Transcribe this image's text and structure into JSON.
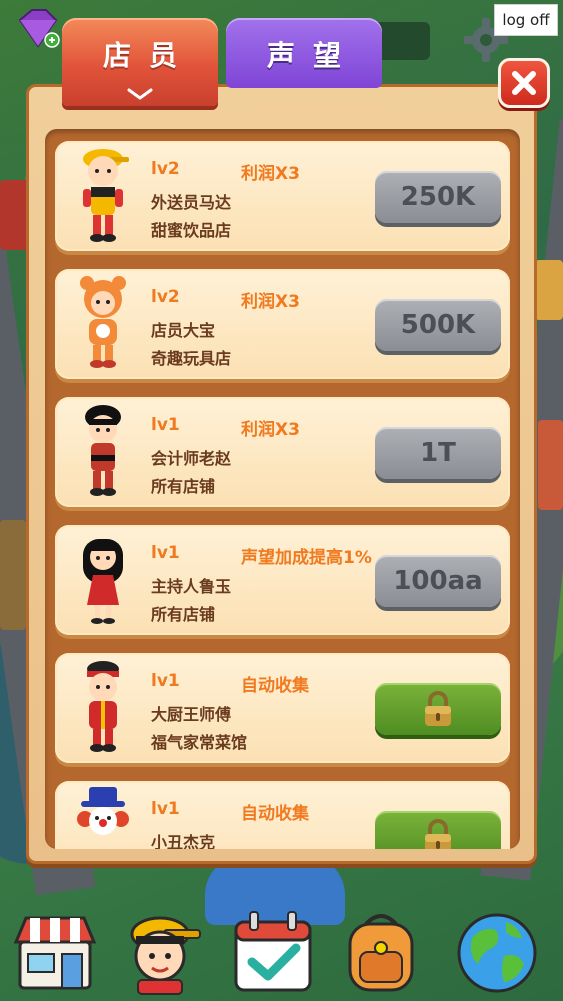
{
  "window": {
    "logoff_label": "log off"
  },
  "tabs": [
    {
      "label": "店员",
      "active": true
    },
    {
      "label": "声望",
      "active": false
    }
  ],
  "colors": {
    "tab_active": "#e1543a",
    "tab_inactive": "#8a4fde",
    "accent_text": "#f07a1f",
    "body_text": "#6a3b1f",
    "price_button": "#9a9da2",
    "lock_button": "#5e9a2a"
  },
  "staff": [
    {
      "level": "lv2",
      "bonus": "利润X3",
      "name": "外送员马达",
      "store": "甜蜜饮品店",
      "action": "price",
      "price": "250K",
      "avatar": "delivery-boy"
    },
    {
      "level": "lv2",
      "bonus": "利润X3",
      "name": "店员大宝",
      "store": "奇趣玩具店",
      "action": "price",
      "price": "500K",
      "avatar": "tiger-costume"
    },
    {
      "level": "lv1",
      "bonus": "利润X3",
      "name": "会计师老赵",
      "store": "所有店铺",
      "action": "price",
      "price": "1T",
      "avatar": "accountant"
    },
    {
      "level": "lv1",
      "bonus": "声望加成提高1%",
      "name": "主持人鲁玉",
      "store": "所有店铺",
      "action": "price",
      "price": "100aa",
      "avatar": "host-girl"
    },
    {
      "level": "lv1",
      "bonus": "自动收集",
      "name": "大厨王师傅",
      "store": "福气家常菜馆",
      "action": "locked",
      "price": "",
      "avatar": "chef"
    },
    {
      "level": "lv1",
      "bonus": "自动收集",
      "name": "小丑杰克",
      "store": "",
      "action": "locked",
      "price": "",
      "avatar": "clown"
    }
  ],
  "bottom_nav": [
    {
      "icon": "shop-icon"
    },
    {
      "icon": "staff-icon"
    },
    {
      "icon": "calendar-check-icon"
    },
    {
      "icon": "backpack-icon"
    },
    {
      "icon": "globe-icon"
    }
  ]
}
